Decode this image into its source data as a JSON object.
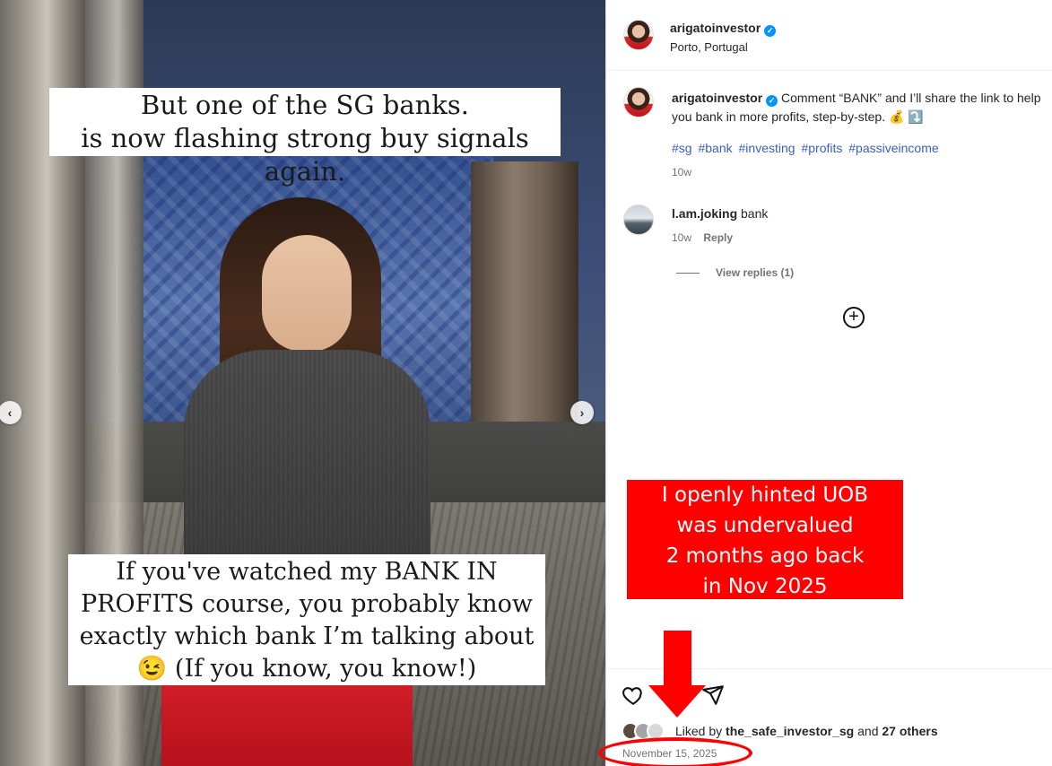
{
  "post_image": {
    "overlay_top": [
      "But one of the SG banks.",
      "is now flashing strong buy signals again."
    ],
    "overlay_bottom": [
      "If you've watched my BANK IN",
      "PROFITS course, you probably know",
      "exactly which bank I’m talking about",
      "😉 (If you know, you know!)"
    ],
    "prev_icon": "chevron-left-icon",
    "next_icon": "chevron-right-icon"
  },
  "header": {
    "username": "arigatoinvestor",
    "verified_icon": "verified-badge-icon",
    "location": "Porto, Portugal"
  },
  "caption": {
    "username": "arigatoinvestor",
    "text": "Comment “BANK” and I’ll share the link to help you bank in more profits, step-by-step. 💰 ⤵️",
    "hashtags": [
      "#sg",
      "#bank",
      "#investing",
      "#profits",
      "#passiveincome"
    ],
    "time": "10w"
  },
  "comments": [
    {
      "username": "l.am.joking",
      "text": "bank",
      "time": "10w",
      "reply_label": "Reply",
      "view_replies": "View replies (1)"
    }
  ],
  "more_comments_icon": "plus-circle-icon",
  "actions": {
    "like_icon": "heart-icon",
    "share_icon": "send-icon",
    "liked_by_prefix": "Liked by",
    "liked_by_user": "the_safe_investor_sg",
    "liked_by_and": "and",
    "liked_by_others": "27 others",
    "date": "November 15, 2025"
  },
  "annotation": {
    "callout_lines": [
      "I openly hinted UOB",
      "was undervalued",
      "2 months ago back",
      "in Nov 2025"
    ],
    "color": "#ff0000"
  }
}
